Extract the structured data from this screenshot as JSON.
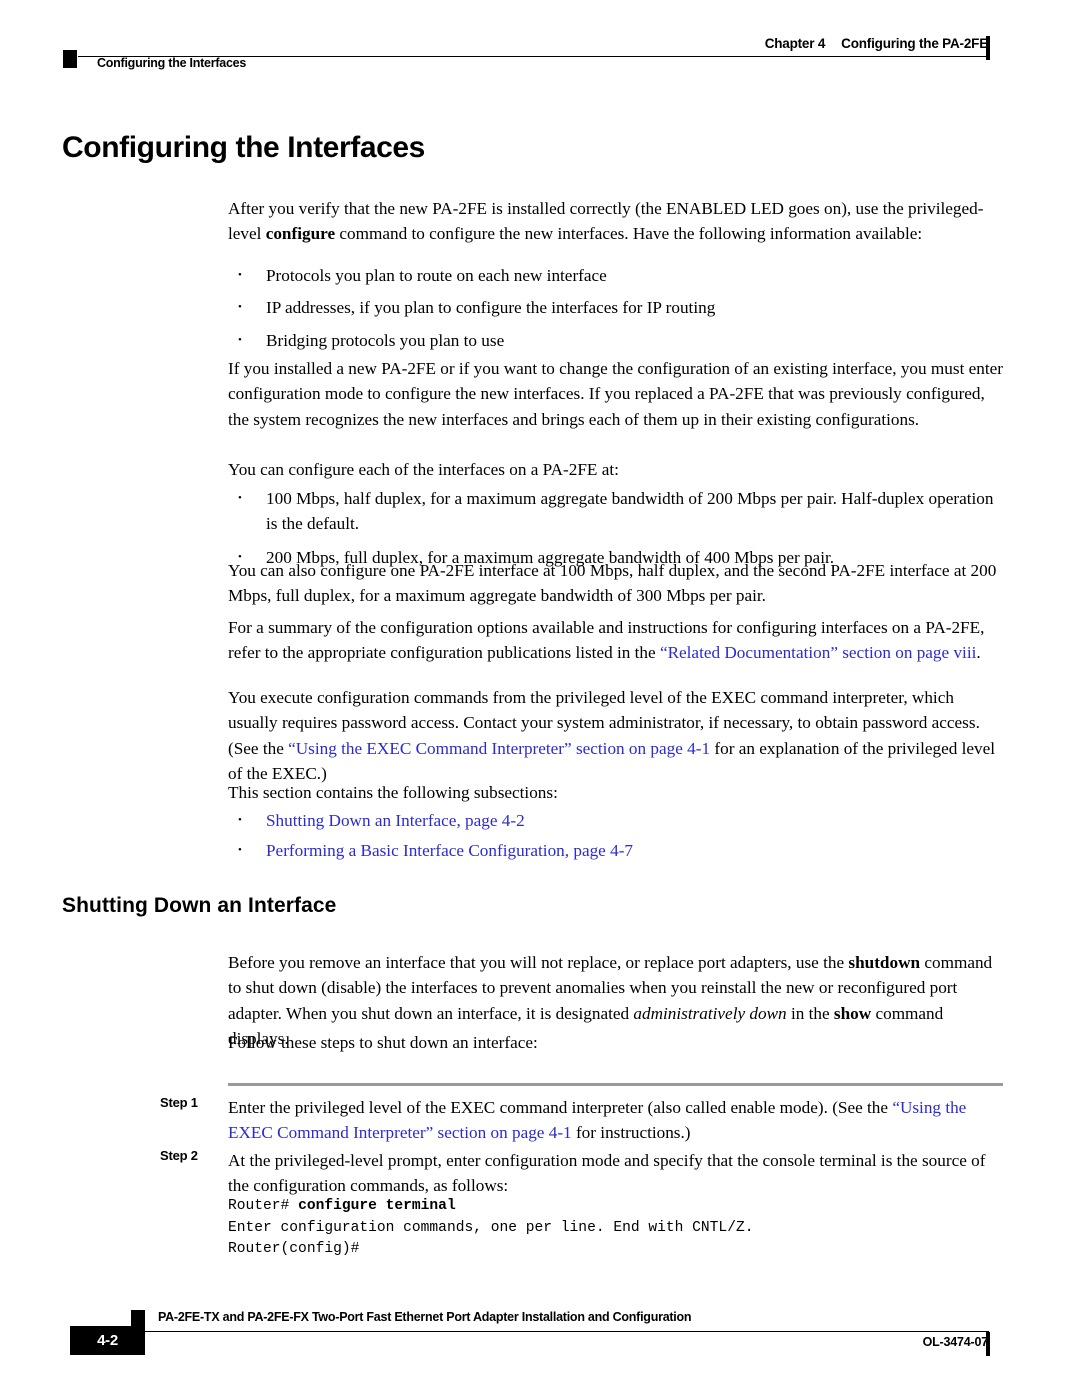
{
  "header": {
    "chapter_number": "Chapter 4",
    "chapter_name": "Configuring the PA-2FE",
    "running_head": "Configuring the Interfaces"
  },
  "chapter_title": "Configuring the Interfaces",
  "intro": {
    "paragraph_1_a": "After you verify that the new PA-2FE is installed correctly (the ENABLED LED goes on), use the privileged-level ",
    "paragraph_1_bold": "configure",
    "paragraph_1_b": " command to configure the new interfaces. Have the following information available:"
  },
  "info_list": [
    "Protocols you plan to route on each new interface",
    "IP addresses, if you plan to configure the interfaces for IP routing",
    "Bridging protocols you plan to use"
  ],
  "paragraphs": {
    "installed_new": "If you installed a new PA-2FE or if you want to change the configuration of an existing interface, you must enter configuration mode to configure the new interfaces. If you replaced a PA-2FE that was previously configured, the system recognizes the new interfaces and brings each of them up in their existing configurations.",
    "configure_each": "You can configure each of the interfaces on a PA-2FE at:",
    "also_configure": "You can also configure one PA-2FE interface at 100 Mbps, half duplex, and the second PA-2FE interface at 200 Mbps, full duplex, for a maximum aggregate bandwidth of 300 Mbps per pair.",
    "summary_a": "For a summary of the configuration options available and instructions for configuring interfaces on a PA-2FE, refer to the appropriate configuration publications listed in the ",
    "summary_link": "“Related Documentation” section on page viii",
    "summary_b": ".",
    "exec_a": "You execute configuration commands from the privileged level of the EXEC command interpreter, which usually requires password access. Contact your system administrator, if necessary, to obtain password access. (See the ",
    "exec_link": "“Using the EXEC Command Interpreter” section on page 4-1",
    "exec_b": " for an explanation of the privileged level of the EXEC.)",
    "subsections_intro": "This section contains the following subsections:"
  },
  "speed_list": [
    "100 Mbps, half duplex, for a maximum aggregate bandwidth of 200 Mbps per pair. Half-duplex operation is the default.",
    "200 Mbps, full duplex, for a maximum aggregate bandwidth of 400 Mbps per pair."
  ],
  "subsection_links": [
    "Shutting Down an Interface, page 4-2",
    "Performing a Basic Interface Configuration, page 4-7"
  ],
  "section": {
    "title": "Shutting Down an Interface",
    "intro_a": "Before you remove an interface that you will not replace, or replace port adapters, use the ",
    "intro_bold_1": "shutdown",
    "intro_b": " command to shut down (disable) the interfaces to prevent anomalies when you reinstall the new or reconfigured port adapter. When you shut down an interface, it is designated ",
    "intro_italic": "administratively down",
    "intro_c": " in the ",
    "intro_bold_2": "show",
    "intro_d": " command displays.",
    "follow_steps": "Follow these steps to shut down an interface:"
  },
  "steps": [
    {
      "label": "Step 1",
      "text_a": "Enter the privileged level of the EXEC command interpreter (also called enable mode). (See the ",
      "link": "“Using the EXEC Command Interpreter” section on page 4-1",
      "text_b": " for instructions.)"
    },
    {
      "label": "Step 2",
      "text_a": "At the privileged-level prompt, enter configuration mode and specify that the console terminal is the source of the configuration commands, as follows:",
      "link": "",
      "text_b": ""
    }
  ],
  "code": {
    "prompt_1": "Router# ",
    "command": "configure terminal",
    "line_2": "Enter configuration commands, one per line. End with CNTL/Z.",
    "line_3": "Router(config)#"
  },
  "footer": {
    "page_number": "4-2",
    "book_title": "PA-2FE-TX and PA-2FE-FX Two-Port Fast Ethernet Port Adapter Installation and Configuration",
    "document_number": "OL-3474-07"
  },
  "colors": {
    "link": "#2B2BD4",
    "text": "#000000",
    "rule": "#9a9a9a"
  }
}
